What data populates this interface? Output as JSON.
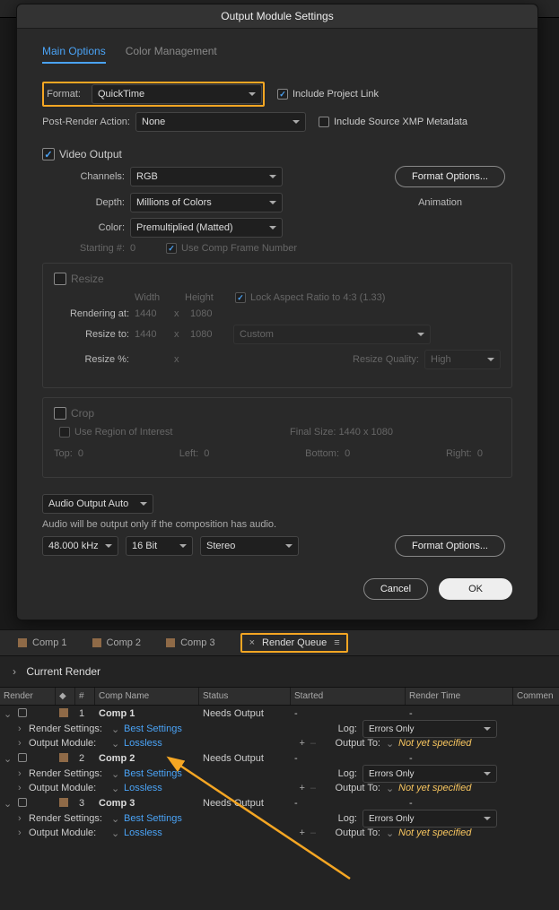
{
  "dialog": {
    "title": "Output Module Settings",
    "tabs": {
      "main": "Main Options",
      "color": "Color Management"
    },
    "format_lbl": "Format:",
    "format_val": "QuickTime",
    "include_link": "Include Project Link",
    "post_render_lbl": "Post-Render Action:",
    "post_render_val": "None",
    "include_xmp": "Include Source XMP Metadata",
    "video_output": "Video Output",
    "channels_lbl": "Channels:",
    "channels_val": "RGB",
    "format_options": "Format Options...",
    "depth_lbl": "Depth:",
    "depth_val": "Millions of Colors",
    "codec": "Animation",
    "color_lbl": "Color:",
    "color_val": "Premultiplied (Matted)",
    "starting_lbl": "Starting #:",
    "starting_val": "0",
    "use_comp_frame": "Use Comp Frame Number",
    "resize": {
      "title": "Resize",
      "width": "Width",
      "height": "Height",
      "lock": "Lock Aspect Ratio to 4:3 (1.33)",
      "rendering_at": "Rendering at:",
      "r_w": "1440",
      "x": "x",
      "r_h": "1080",
      "resize_to": "Resize to:",
      "rt_w": "1440",
      "rt_h": "1080",
      "preset": "Custom",
      "resize_pct": "Resize %:",
      "quality_lbl": "Resize Quality:",
      "quality_val": "High"
    },
    "crop": {
      "title": "Crop",
      "roi": "Use Region of Interest",
      "final_size": "Final Size: 1440 x 1080",
      "top": "Top:",
      "top_v": "0",
      "left": "Left:",
      "left_v": "0",
      "bottom": "Bottom:",
      "bottom_v": "0",
      "right": "Right:",
      "right_v": "0"
    },
    "audio": {
      "mode": "Audio Output Auto",
      "note": "Audio will be output only if the composition has audio.",
      "rate": "48.000 kHz",
      "depth": "16 Bit",
      "channels": "Stereo",
      "format_options": "Format Options..."
    },
    "cancel": "Cancel",
    "ok": "OK"
  },
  "panel_tabs": {
    "comp1": "Comp 1",
    "comp2": "Comp 2",
    "comp3": "Comp 3",
    "render_queue": "Render Queue"
  },
  "render_queue": {
    "current": "Current Render",
    "headers": {
      "render": "Render",
      "num": "#",
      "comp": "Comp Name",
      "status": "Status",
      "started": "Started",
      "time": "Render Time",
      "comment": "Commen"
    },
    "items": [
      {
        "num": "1",
        "name": "Comp 1",
        "status": "Needs Output",
        "dash": "-"
      },
      {
        "num": "2",
        "name": "Comp 2",
        "status": "Needs Output",
        "dash": "-"
      },
      {
        "num": "3",
        "name": "Comp 3",
        "status": "Needs Output",
        "dash": "-"
      }
    ],
    "sub": {
      "render_settings": "Render Settings:",
      "best": "Best Settings",
      "output_module": "Output Module:",
      "lossless": "Lossless",
      "log": "Log:",
      "errors_only": "Errors Only",
      "output_to": "Output To:",
      "notyet": "Not yet specified",
      "plus": "+",
      "minus": "–"
    }
  }
}
